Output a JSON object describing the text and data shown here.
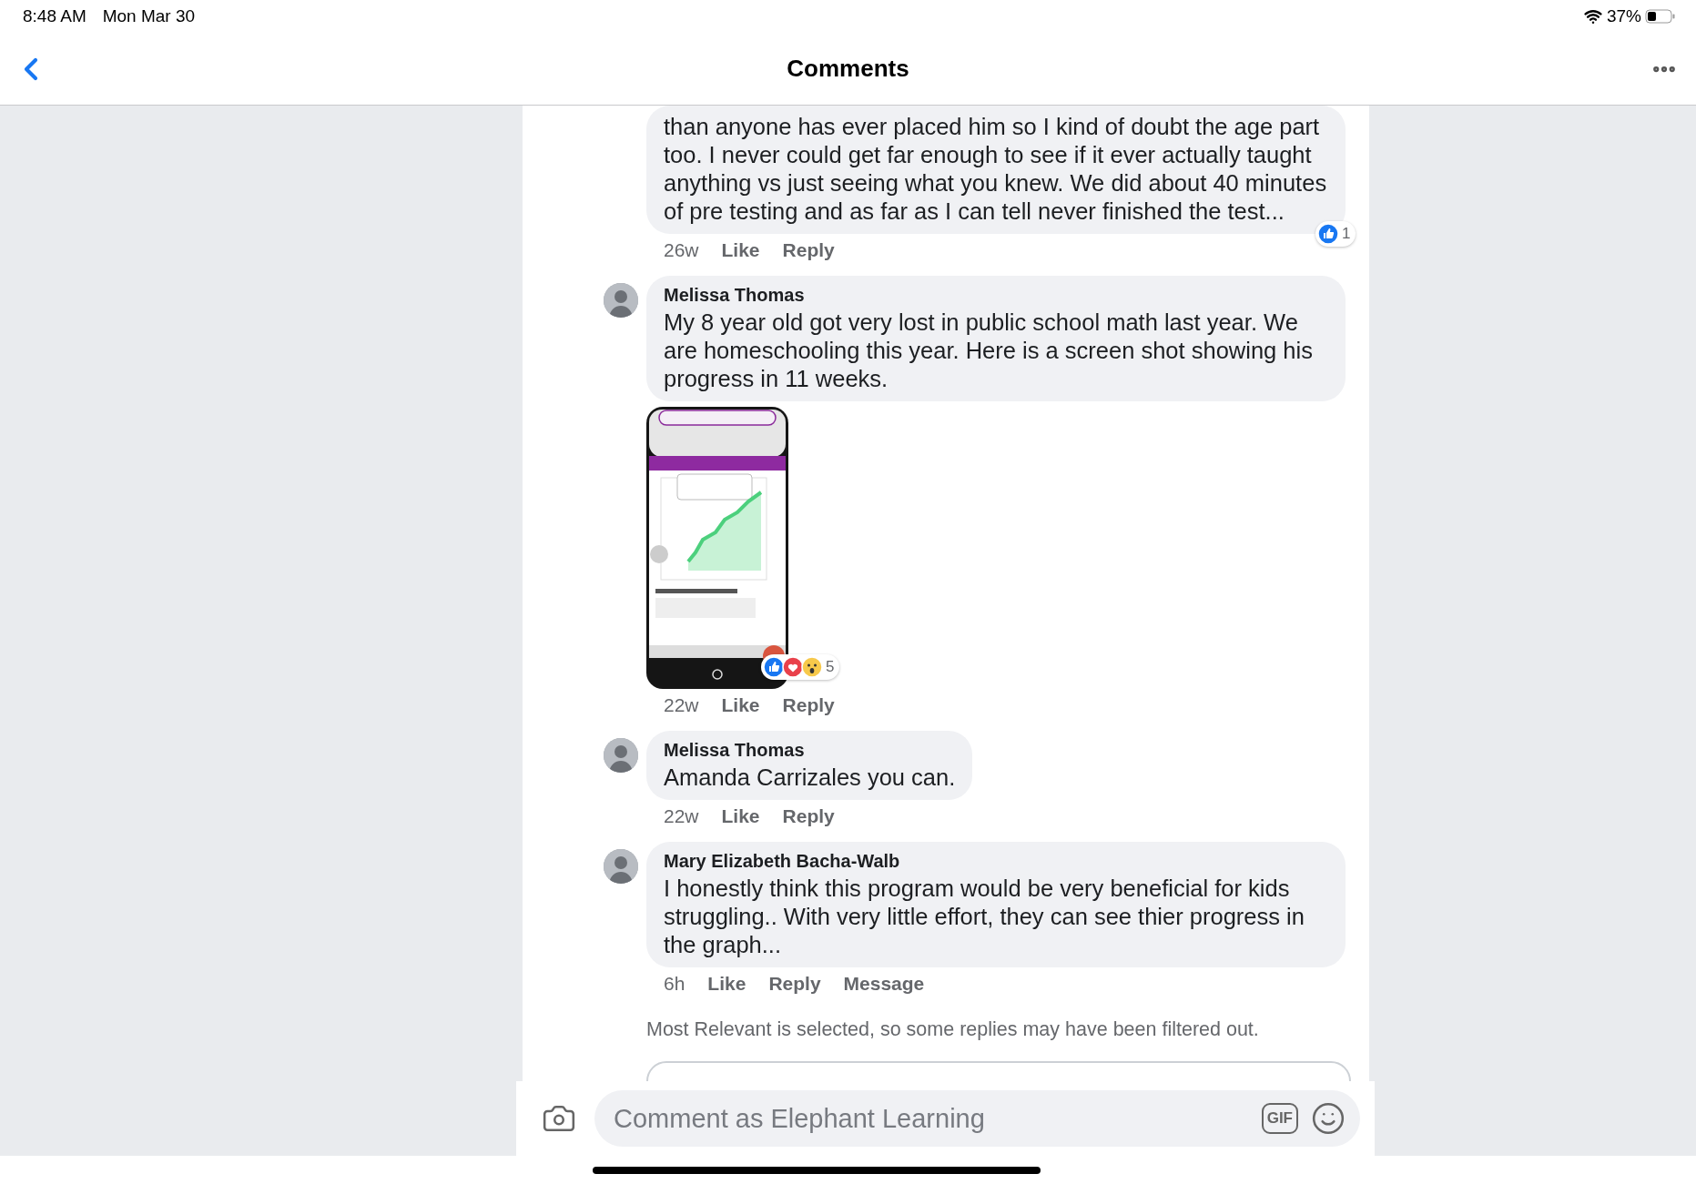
{
  "status_bar": {
    "time": "8:48 AM",
    "date": "Mon Mar 30",
    "battery": "37%"
  },
  "nav": {
    "title": "Comments"
  },
  "comments": [
    {
      "text": "than anyone has ever placed him so I kind of doubt the age part too. I never could get far enough to see if it ever actually taught anything vs just seeing what you knew. We did about 40 minutes of pre testing and as far as I can tell never finished the test...",
      "time": "26w",
      "actions": [
        "Like",
        "Reply"
      ],
      "reactions": {
        "icons": [
          {
            "kind": "like"
          }
        ],
        "count": "1"
      }
    },
    {
      "author": "Melissa Thomas",
      "text": "My 8 year old got very lost in public school math last year. We are homeschooling this year. Here is a screen shot showing his progress in 11 weeks.",
      "time": "22w",
      "actions": [
        "Like",
        "Reply"
      ],
      "reactions": {
        "icons": [
          {
            "kind": "like"
          },
          {
            "kind": "love"
          },
          {
            "kind": "wow"
          }
        ],
        "count": "5"
      },
      "attachment": {
        "kind": "picture"
      }
    },
    {
      "author": "Melissa Thomas",
      "text": "Amanda Carrizales you can.",
      "time": "22w",
      "actions": [
        "Like",
        "Reply"
      ]
    },
    {
      "author": "Mary Elizabeth Bacha-Walb",
      "text": "I honestly think this program would be very beneficial for kids struggling.. With very little effort, they can see thier progress in the graph...",
      "time": "6h",
      "actions": [
        "Like",
        "Reply",
        "Message"
      ]
    }
  ],
  "filter_note": "Most Relevant is selected, so some replies may have been filtered out.",
  "composer": {
    "placeholder": "Comment as Elephant Learning",
    "gif_label": "GIF"
  }
}
